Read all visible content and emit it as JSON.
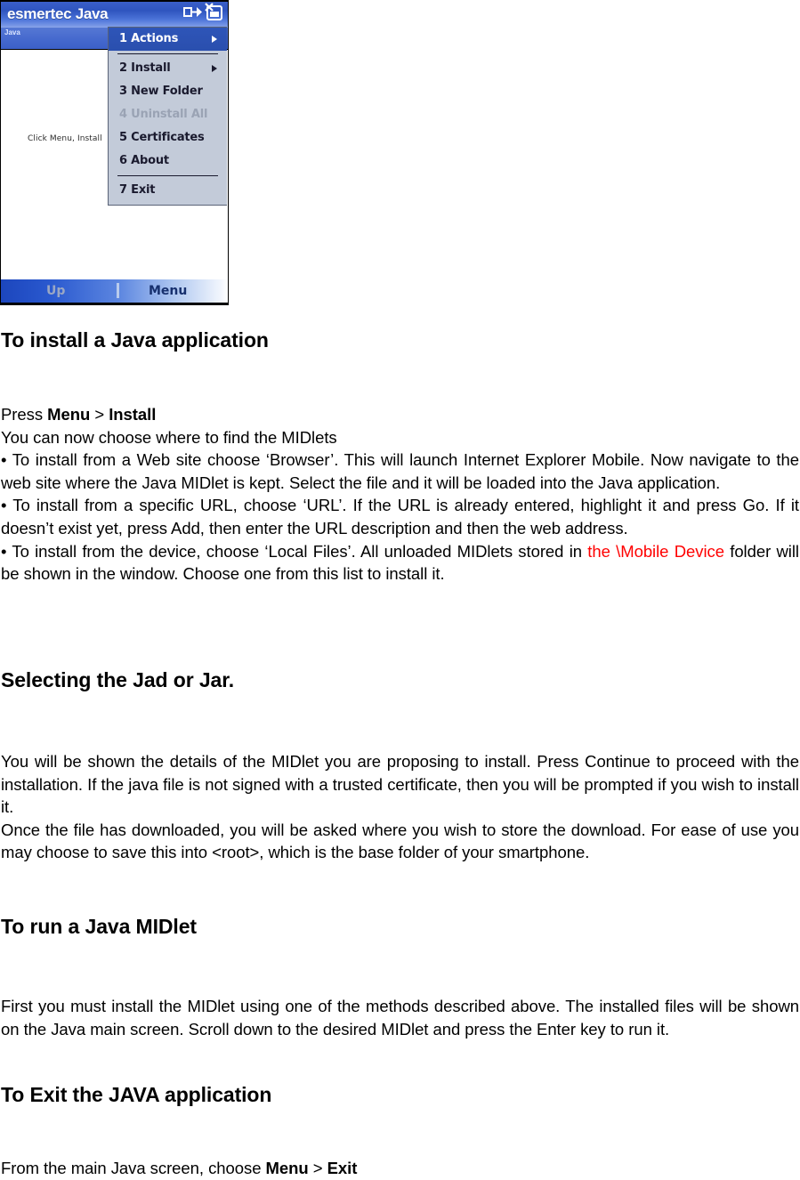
{
  "screenshot": {
    "title_bar": {
      "app_title": "esmertec Java",
      "icons": [
        "connectivity-icon",
        "volume-off-icon"
      ]
    },
    "sub_bar": {
      "label": "Java"
    },
    "canvas": {
      "hint": "Click Menu, Install"
    },
    "popup_menu": {
      "items": [
        {
          "label": "1 Actions",
          "state": "selected",
          "submenu": true
        },
        {
          "separator": true
        },
        {
          "label": "2 Install",
          "state": "normal",
          "submenu": true
        },
        {
          "label": "3 New Folder",
          "state": "normal",
          "submenu": false
        },
        {
          "label": "4 Uninstall All",
          "state": "disabled",
          "submenu": false
        },
        {
          "label": "5 Certificates",
          "state": "normal",
          "submenu": false
        },
        {
          "label": "6 About",
          "state": "normal",
          "submenu": false
        },
        {
          "separator": true
        },
        {
          "label": "7 Exit",
          "state": "normal",
          "submenu": false
        }
      ]
    },
    "soft_keys": {
      "left": "Up",
      "right": "Menu"
    },
    "colors": {
      "title_bar_blue": "#2f55bf",
      "menu_background": "#c3cbd9",
      "menu_selected": "#2e55b8",
      "menu_disabled_text": "#9aa3b4",
      "softkey_left_text": "#9aa7c4",
      "softkey_right_text": "#17306e"
    }
  },
  "document": {
    "heading_1": "To install a Java application",
    "para_1": {
      "line_1_prefix": "Press ",
      "line_1_bold_1": "Menu",
      "line_1_mid": " > ",
      "line_1_bold_2": "Install",
      "line_2": "You can now choose where to find the MIDlets",
      "bullet_1": "•  To install from a Web site choose ‘Browser’. This will launch Internet Explorer Mobile. Now navigate to the web site where the Java MIDlet is kept. Select the file and it will be loaded into the Java application.",
      "bullet_2": "•  To install from a specific URL, choose ‘URL’. If the URL is already entered, highlight it and press Go. If it doesn’t exist yet, press Add, then enter the URL description and then the web address.",
      "bullet_3_part_1": "•  To install from the device, choose ‘Local Files’. All unloaded MIDlets stored in ",
      "bullet_3_red": "the \\Mobile Device",
      "bullet_3_part_2": " folder will be shown in the window. Choose one from this list to install it."
    },
    "heading_2": "Selecting the Jad or Jar.",
    "para_2": {
      "block_1": "You will be shown the details of the MIDlet you are proposing to install. Press Continue to proceed with the installation. If the java file is not signed with a trusted certificate, then you will be prompted if you wish to install it.",
      "block_2": "Once the file has downloaded, you will be asked where you wish to store the download. For ease of use you may choose to save this into <root>, which is the base folder of your smartphone."
    },
    "heading_3": "To run a Java MIDlet",
    "para_3": {
      "block_1": "First you must install the MIDlet using one of the methods described above. The installed files will be shown on the Java main screen. Scroll down to the desired MIDlet and press the Enter key to run it."
    },
    "heading_4": "To Exit the JAVA application",
    "para_4": {
      "prefix": "From the main Java screen, choose ",
      "bold_1": "Menu",
      "mid": " > ",
      "bold_2": "Exit"
    },
    "colors": {
      "text": "#000000",
      "highlight_red": "#ff0000"
    }
  }
}
